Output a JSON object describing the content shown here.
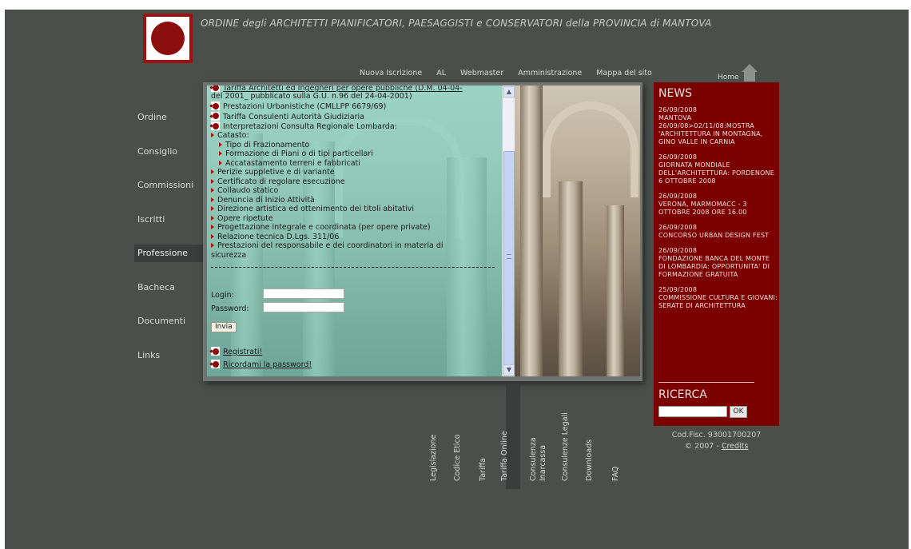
{
  "header": {
    "site_title": "ORDINE degli ARCHITETTI PIANIFICATORI, PAESAGGISTI e CONSERVATORI della PROVINCIA di MANTOVA"
  },
  "top_nav": [
    {
      "label": "Nuova Iscrizione"
    },
    {
      "label": "AL"
    },
    {
      "label": "Webmaster"
    },
    {
      "label": "Amministrazione"
    },
    {
      "label": "Mappa del sito"
    }
  ],
  "home": {
    "label": "Home",
    "icon": "home-icon"
  },
  "left_menu": [
    {
      "label": "Ordine",
      "active": false
    },
    {
      "label": "Consiglio",
      "active": false
    },
    {
      "label": "Commissioni",
      "active": false
    },
    {
      "label": "Iscritti",
      "active": false
    },
    {
      "label": "Professione",
      "active": true
    },
    {
      "label": "Bacheca",
      "active": false
    },
    {
      "label": "Documenti",
      "active": false
    },
    {
      "label": "Links",
      "active": false
    }
  ],
  "content": {
    "partial_first_line": "Tariffa Architetti ed Ingegneri per opere pubbliche (D.M. 04-04-",
    "partial_second_line": "del 2001_ pubblicato sulla G.U. n.96 del 24-04-2001)",
    "icon_items": [
      {
        "label": "Prestazioni Urbanistiche (CMLLPP 6679/69)"
      },
      {
        "label": "Tariffa Consulenti Autorità Giudiziaria"
      },
      {
        "label": "Interpretazioni Consulta Regionale Lombarda:"
      }
    ],
    "catasto": {
      "label": "Catasto:",
      "subitems": [
        {
          "label": "Tipo di Frazionamento"
        },
        {
          "label": "Formazione di Piani o di tipi particellari"
        },
        {
          "label": "Accatastamento terreni e fabbricati"
        }
      ]
    },
    "arrow_items": [
      {
        "label": "Perizie suppletive e di variante"
      },
      {
        "label": "Certificato di regolare esecuzione"
      },
      {
        "label": "Collaudo statico"
      },
      {
        "label": "Denuncia di Inizio Attività"
      },
      {
        "label": "Direzione artistica ed ottenimento dei titoli abitativi"
      },
      {
        "label": "Opere ripetute"
      },
      {
        "label": "Progettazione integrale e coordinata (per opere private)"
      },
      {
        "label": "Relazione tecnica D.Lgs. 311/06"
      },
      {
        "label": "Prestazioni del responsabile e dei coordinatori in materia di"
      }
    ],
    "last_item_continuation": "sicurezza"
  },
  "login_form": {
    "login_label": "Login:",
    "login_value": "",
    "password_label": "Password:",
    "password_value": "",
    "submit_label": "Invia",
    "register_link": "Registrati!",
    "remember_link": "Ricordami la password!"
  },
  "vertical_tabs": [
    {
      "label": "Legislazione",
      "active": false
    },
    {
      "label": "Codice Etico",
      "active": false
    },
    {
      "label": "Tariffa",
      "active": false
    },
    {
      "label": "Tariffa Online",
      "active": true
    },
    {
      "label": "Consulenza Inarcassa",
      "line1": "Consulenza",
      "line2": "Inarcassa",
      "active": false
    },
    {
      "label": "Consulenze Legali",
      "active": false
    },
    {
      "label": "Downloads",
      "active": false
    },
    {
      "label": "FAQ",
      "active": false
    }
  ],
  "news": {
    "title": "NEWS",
    "items": [
      {
        "date": "26/09/2008",
        "text": "MANTOVA 26/09/08>02/11/08:MOSTRA 'ARCHITETTURA IN MONTAGNA, GINO VALLE IN CARNIA"
      },
      {
        "date": "26/09/2008",
        "text": "GIORNATA MONDIALE DELL'ARCHITETTURA: PORDENONE 6 OTTOBRE 2008"
      },
      {
        "date": "26/09/2008",
        "text": "VERONA, MARMOMACC - 3 OTTOBRE 2008 ORE 16.00"
      },
      {
        "date": "26/09/2008",
        "text": "CONCORSO URBAN DESIGN FEST"
      },
      {
        "date": "26/09/2008",
        "text": "FONDAZIONE BANCA DEL MONTE DI LOMBARDIA: OPPORTUNITA' DI FORMAZIONE GRATUITA"
      },
      {
        "date": "25/09/2008",
        "text": "COMMISSIONE CULTURA E GIOVANI: SERATE DI ARCHITETTURA"
      }
    ]
  },
  "search": {
    "title": "RICERCA",
    "value": "",
    "button_label": "OK"
  },
  "footer": {
    "codfisc": "Cod.Fisc. 93001700207",
    "copyright": "© 2007 - ",
    "credits_link": "Credits"
  },
  "colors": {
    "background": "#4a4f4b",
    "news_background": "#7b0101",
    "logo_red": "#8b0d0d",
    "text_overlay": "#7adccd"
  }
}
